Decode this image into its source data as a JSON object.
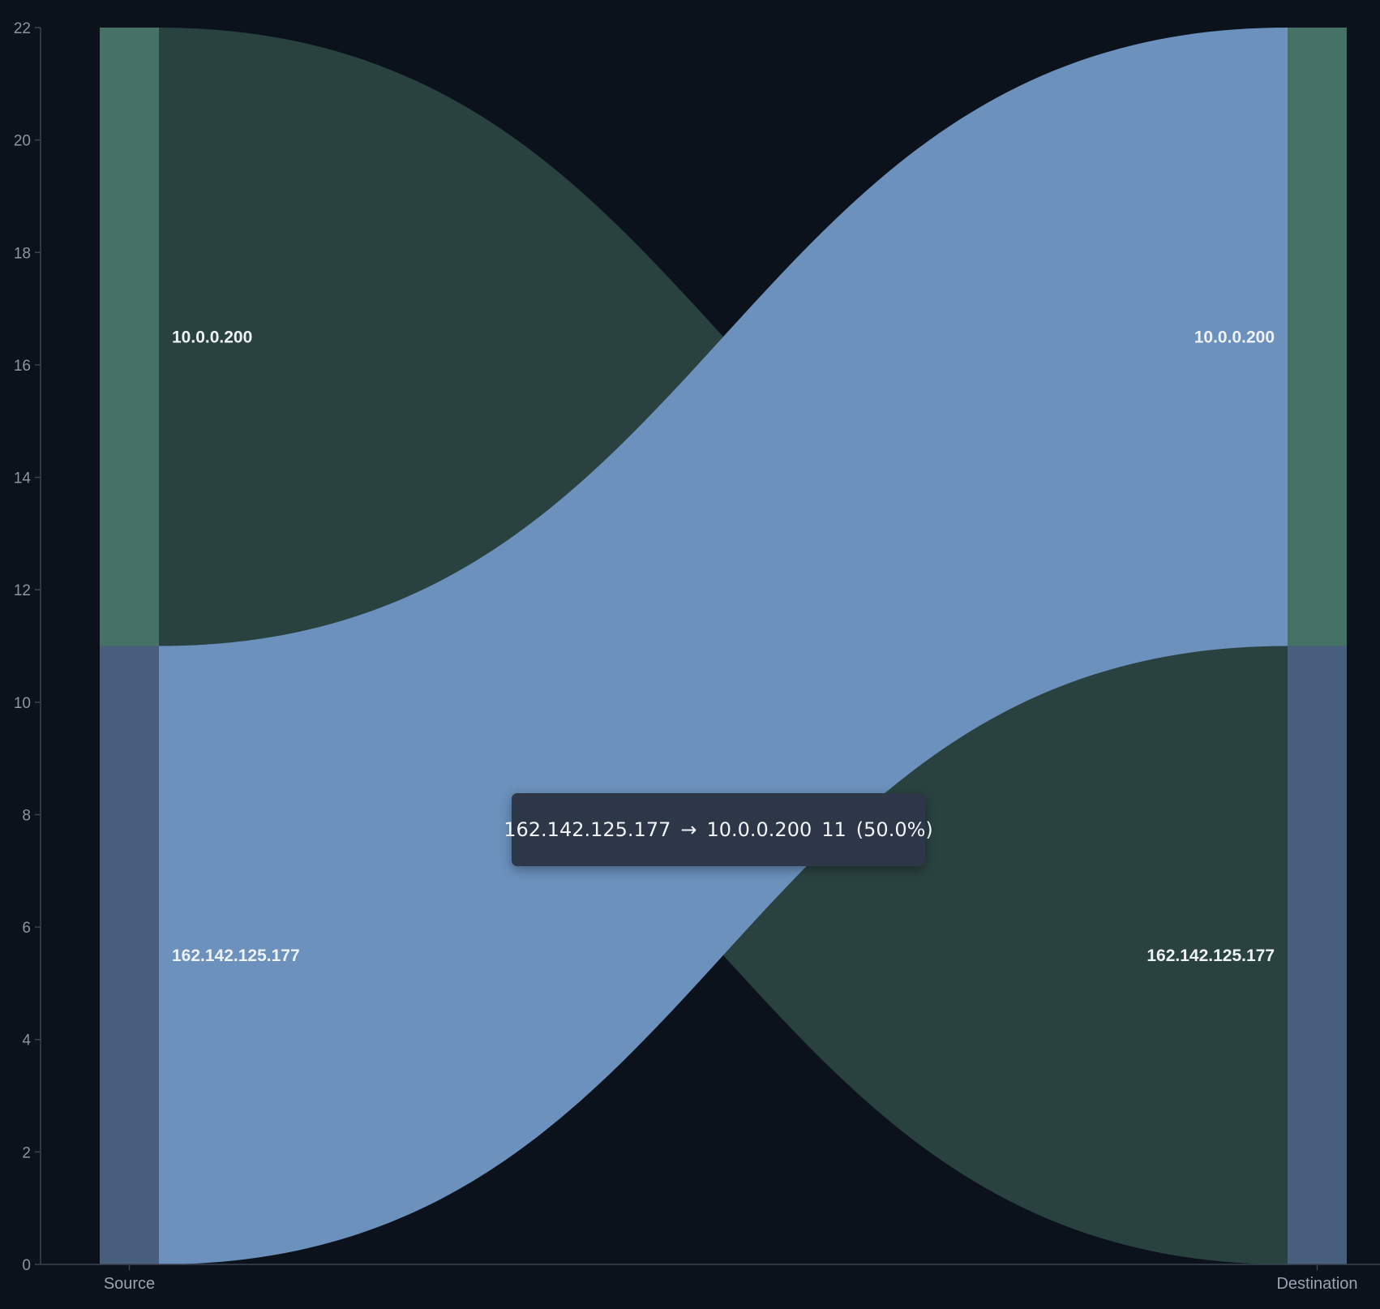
{
  "chart_data": {
    "type": "sankey",
    "yaxis": {
      "ylim": [
        0,
        22
      ],
      "ticks": [
        "0",
        "2",
        "4",
        "6",
        "8",
        "10",
        "12",
        "14",
        "16",
        "18",
        "20",
        "22"
      ]
    },
    "columns": [
      "Source",
      "Destination"
    ],
    "nodes": {
      "source": [
        {
          "id": "s_10",
          "label": "10.0.0.200",
          "value": 11,
          "color": "#467266"
        },
        {
          "id": "s_162",
          "label": "162.142.125.177",
          "value": 11,
          "color": "#475f7c"
        }
      ],
      "destination": [
        {
          "id": "d_10",
          "label": "10.0.0.200",
          "value": 11,
          "color": "#467266"
        },
        {
          "id": "d_162",
          "label": "162.142.125.177",
          "value": 11,
          "color": "#475f7c"
        }
      ]
    },
    "links": [
      {
        "source": "10.0.0.200",
        "target": "162.142.125.177",
        "value": 11,
        "color": "#294240"
      },
      {
        "source": "162.142.125.177",
        "target": "10.0.0.200",
        "value": 11,
        "color": "#6b91bc",
        "highlighted": true
      }
    ]
  },
  "tooltip": {
    "source": "162.142.125.177",
    "arrow": "→",
    "target": "10.0.0.200",
    "value": "11",
    "percent": "(50.0%)"
  },
  "colors": {
    "background": "#0b121b",
    "axis": "#3a4452"
  }
}
